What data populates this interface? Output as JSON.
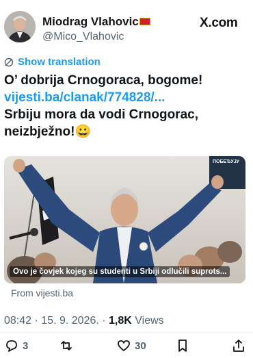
{
  "author": {
    "display_name": "Miodrag Vlahovic",
    "handle": "@Mico_Vlahovic"
  },
  "platform": {
    "label": "X.com"
  },
  "translation": {
    "label": "Show translation"
  },
  "tweet": {
    "line1": "O’ dobrija Crnogoraca, bogome!",
    "link": "vijesti.ba/clanak/774828/...",
    "line3": "Srbiju mora da vodi Crnogorac,",
    "line4": "neizbježno!",
    "emoji": "😀"
  },
  "card": {
    "caption": "Ovo je čovjek kojeg su studenti u Srbiji odlučili suprots...",
    "source": "From vijesti.ba",
    "banner_text": "ПОБЕЂУЈУ"
  },
  "meta": {
    "time": "08:42",
    "date": "15. 9. 2026.",
    "views_count": "1,8K",
    "views_label": "Views"
  },
  "actions": {
    "replies": "3",
    "likes": "30"
  },
  "colors": {
    "accent": "#1d9bf0",
    "secondary_text": "#536471"
  }
}
